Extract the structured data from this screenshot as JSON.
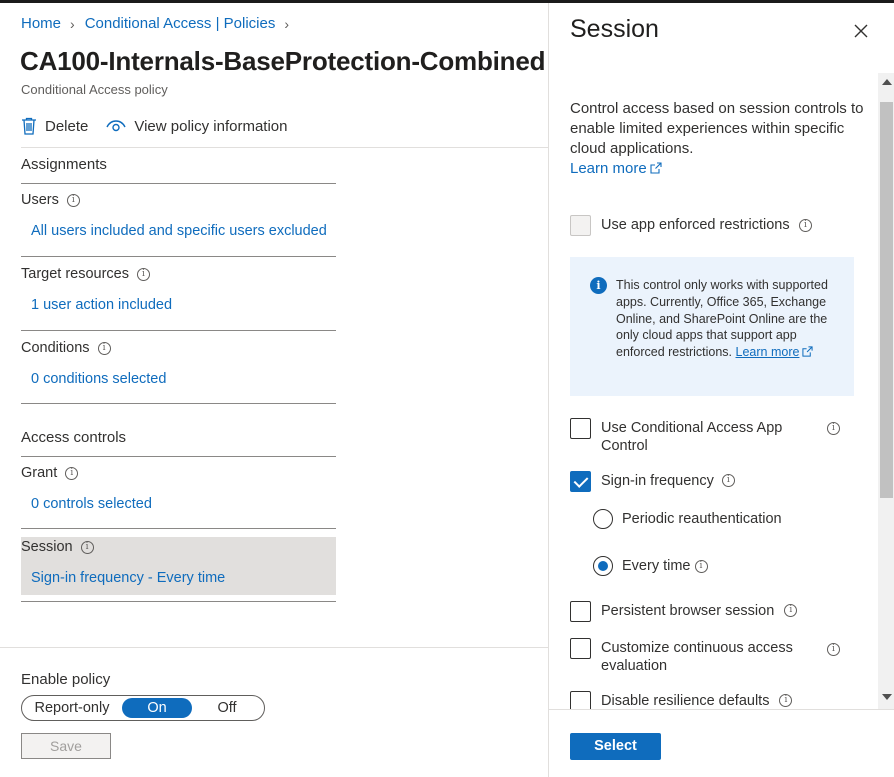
{
  "breadcrumb": {
    "items": [
      "Home",
      "Conditional Access | Policies"
    ]
  },
  "page": {
    "title": "CA100-Internals-BaseProtection-Combined",
    "subtitle": "Conditional Access policy"
  },
  "toolbar": {
    "delete_label": "Delete",
    "view_info_label": "View policy information"
  },
  "assignments": {
    "heading": "Assignments",
    "users_label": "Users",
    "users_value": "All users included and specific users excluded",
    "target_label": "Target resources",
    "target_value": "1 user action included",
    "conditions_label": "Conditions",
    "conditions_value": "0 conditions selected"
  },
  "access_controls": {
    "heading": "Access controls",
    "grant_label": "Grant",
    "grant_value": "0 controls selected",
    "session_label": "Session",
    "session_value": "Sign-in frequency - Every time"
  },
  "enable_policy": {
    "label": "Enable policy",
    "options": [
      "Report-only",
      "On",
      "Off"
    ],
    "selected": "On",
    "save_label": "Save"
  },
  "panel": {
    "title": "Session",
    "description": "Control access based on session controls to enable limited experiences within specific cloud applications.",
    "learn_more": "Learn more",
    "app_enforced": "Use app enforced restrictions",
    "info_text": "This control only works with supported apps. Currently, Office 365, Exchange Online, and SharePoint Online are the only cloud apps that support app enforced restrictions.",
    "info_learn_more": "Learn more",
    "ca_app_control": "Use Conditional Access App Control",
    "sign_in_frequency": "Sign-in frequency",
    "periodic": "Periodic reauthentication",
    "every_time": "Every time",
    "persistent": "Persistent browser session",
    "cae": "Customize continuous access evaluation",
    "resilience": "Disable resilience defaults",
    "select_label": "Select"
  },
  "colors": {
    "accent": "#0f6cbd",
    "session_highlight": "#e1dfdd"
  }
}
